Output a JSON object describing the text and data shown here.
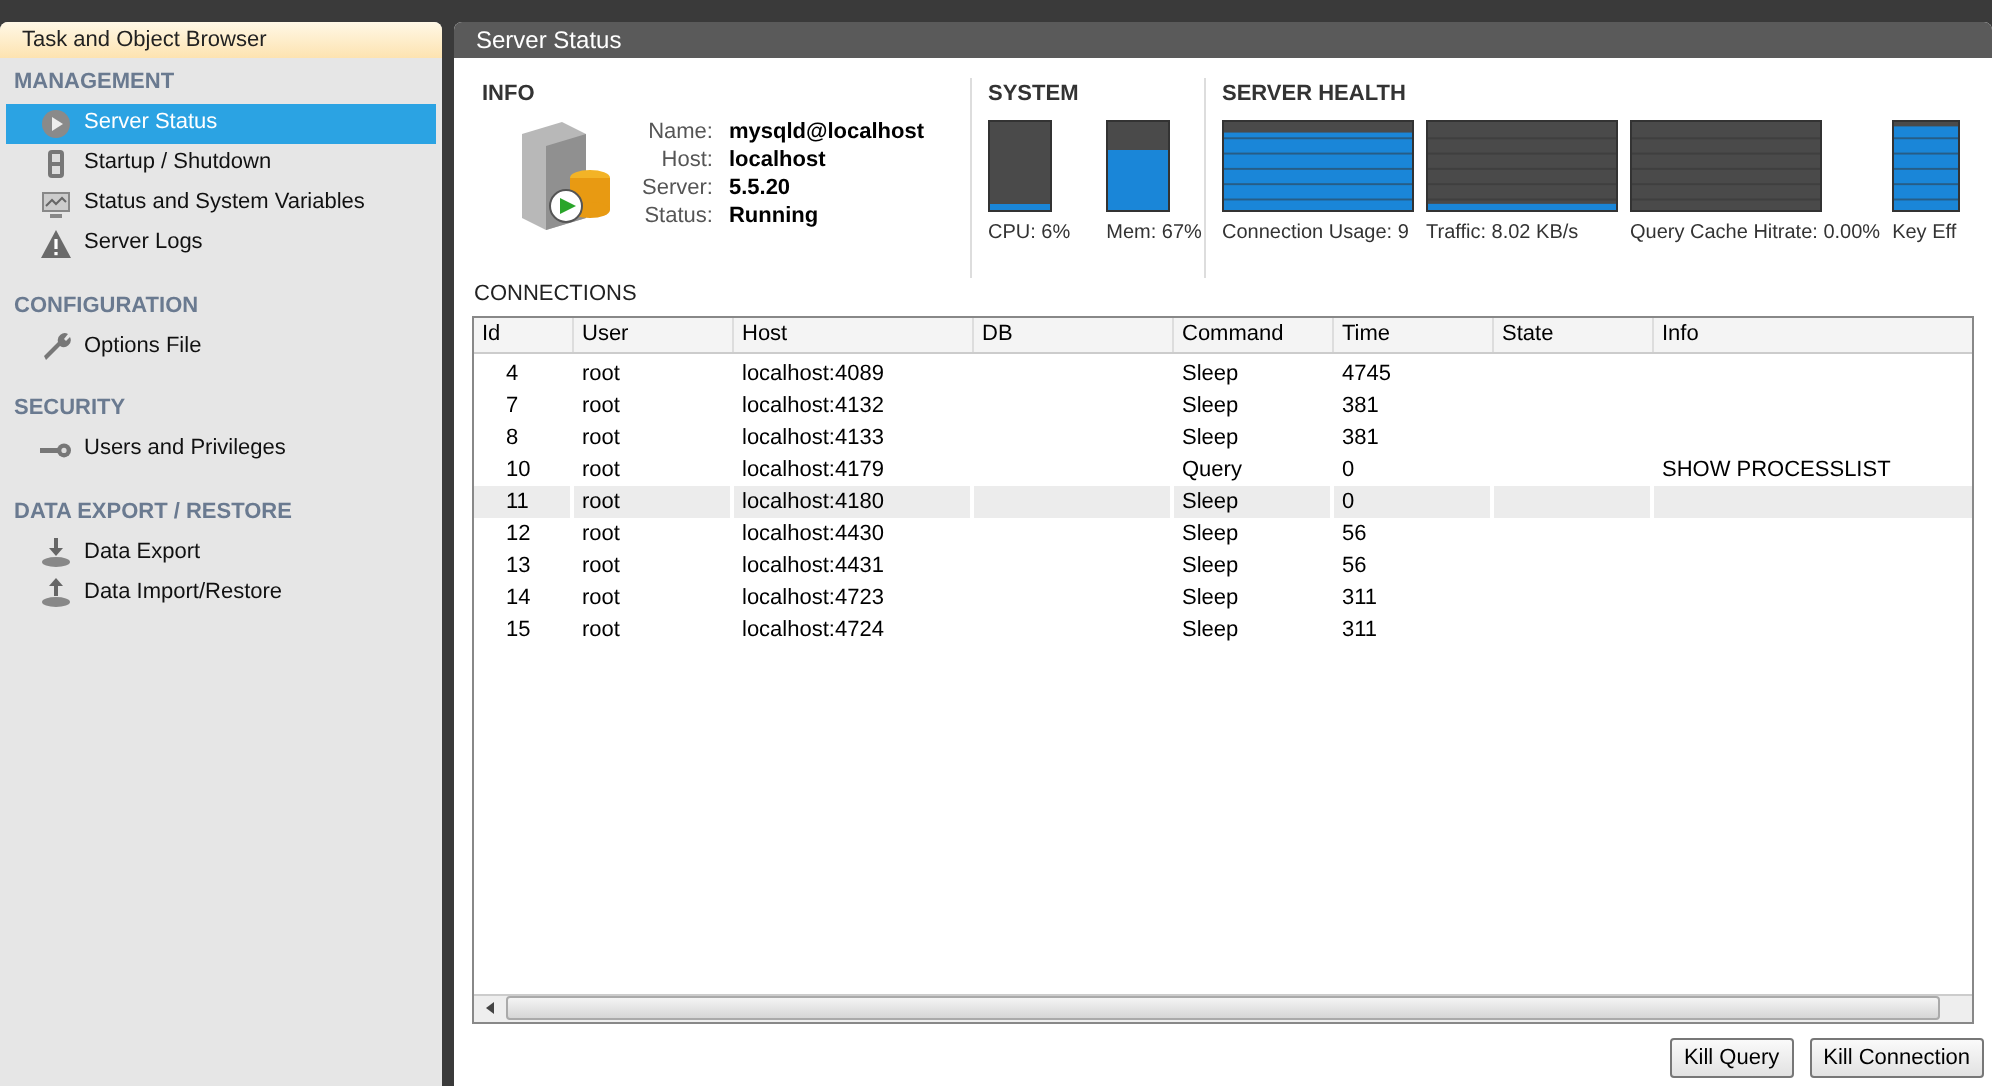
{
  "sidebar": {
    "title": "Task and Object Browser",
    "sections": [
      {
        "heading": "MANAGEMENT",
        "items": [
          {
            "label": "Server Status",
            "selected": true
          },
          {
            "label": "Startup / Shutdown",
            "selected": false
          },
          {
            "label": "Status and System Variables",
            "selected": false
          },
          {
            "label": "Server Logs",
            "selected": false
          }
        ]
      },
      {
        "heading": "CONFIGURATION",
        "items": [
          {
            "label": "Options File",
            "selected": false
          }
        ]
      },
      {
        "heading": "SECURITY",
        "items": [
          {
            "label": "Users and Privileges",
            "selected": false
          }
        ]
      },
      {
        "heading": "DATA EXPORT / RESTORE",
        "items": [
          {
            "label": "Data Export",
            "selected": false
          },
          {
            "label": "Data Import/Restore",
            "selected": false
          }
        ]
      }
    ]
  },
  "panel": {
    "title": "Server Status",
    "info": {
      "heading": "INFO",
      "fields": [
        {
          "label": "Name:",
          "value": "mysqld@localhost"
        },
        {
          "label": "Host:",
          "value": "localhost"
        },
        {
          "label": "Server:",
          "value": "5.5.20"
        },
        {
          "label": "Status:",
          "value": "Running"
        }
      ]
    },
    "system": {
      "heading": "SYSTEM",
      "meters": [
        {
          "label": "CPU: 6%",
          "level": 0.06
        },
        {
          "label": "Mem: 67%",
          "level": 0.67
        }
      ]
    },
    "health": {
      "heading": "SERVER HEALTH",
      "meters": [
        {
          "label": "Connection Usage: 9"
        },
        {
          "label": "Traffic: 8.02 KB/s"
        },
        {
          "label": "Query Cache Hitrate: 0.00%"
        },
        {
          "label": "Key Eff"
        }
      ]
    },
    "connections": {
      "heading": "CONNECTIONS",
      "columns": [
        "Id",
        "User",
        "Host",
        "DB",
        "Command",
        "Time",
        "State",
        "Info"
      ],
      "rows": [
        {
          "cells": [
            "4",
            "root",
            "localhost:4089",
            "",
            "Sleep",
            "4745",
            "",
            ""
          ],
          "selected": false
        },
        {
          "cells": [
            "7",
            "root",
            "localhost:4132",
            "",
            "Sleep",
            "381",
            "",
            ""
          ],
          "selected": false
        },
        {
          "cells": [
            "8",
            "root",
            "localhost:4133",
            "",
            "Sleep",
            "381",
            "",
            ""
          ],
          "selected": false
        },
        {
          "cells": [
            "10",
            "root",
            "localhost:4179",
            "",
            "Query",
            "0",
            "",
            "SHOW PROCESSLIST"
          ],
          "selected": false
        },
        {
          "cells": [
            "11",
            "root",
            "localhost:4180",
            "",
            "Sleep",
            "0",
            "",
            ""
          ],
          "selected": true
        },
        {
          "cells": [
            "12",
            "root",
            "localhost:4430",
            "",
            "Sleep",
            "56",
            "",
            ""
          ],
          "selected": false
        },
        {
          "cells": [
            "13",
            "root",
            "localhost:4431",
            "",
            "Sleep",
            "56",
            "",
            ""
          ],
          "selected": false
        },
        {
          "cells": [
            "14",
            "root",
            "localhost:4723",
            "",
            "Sleep",
            "311",
            "",
            ""
          ],
          "selected": false
        },
        {
          "cells": [
            "15",
            "root",
            "localhost:4724",
            "",
            "Sleep",
            "311",
            "",
            ""
          ],
          "selected": false
        }
      ]
    },
    "buttons": [
      "Kill Query",
      "Kill Connection"
    ]
  }
}
